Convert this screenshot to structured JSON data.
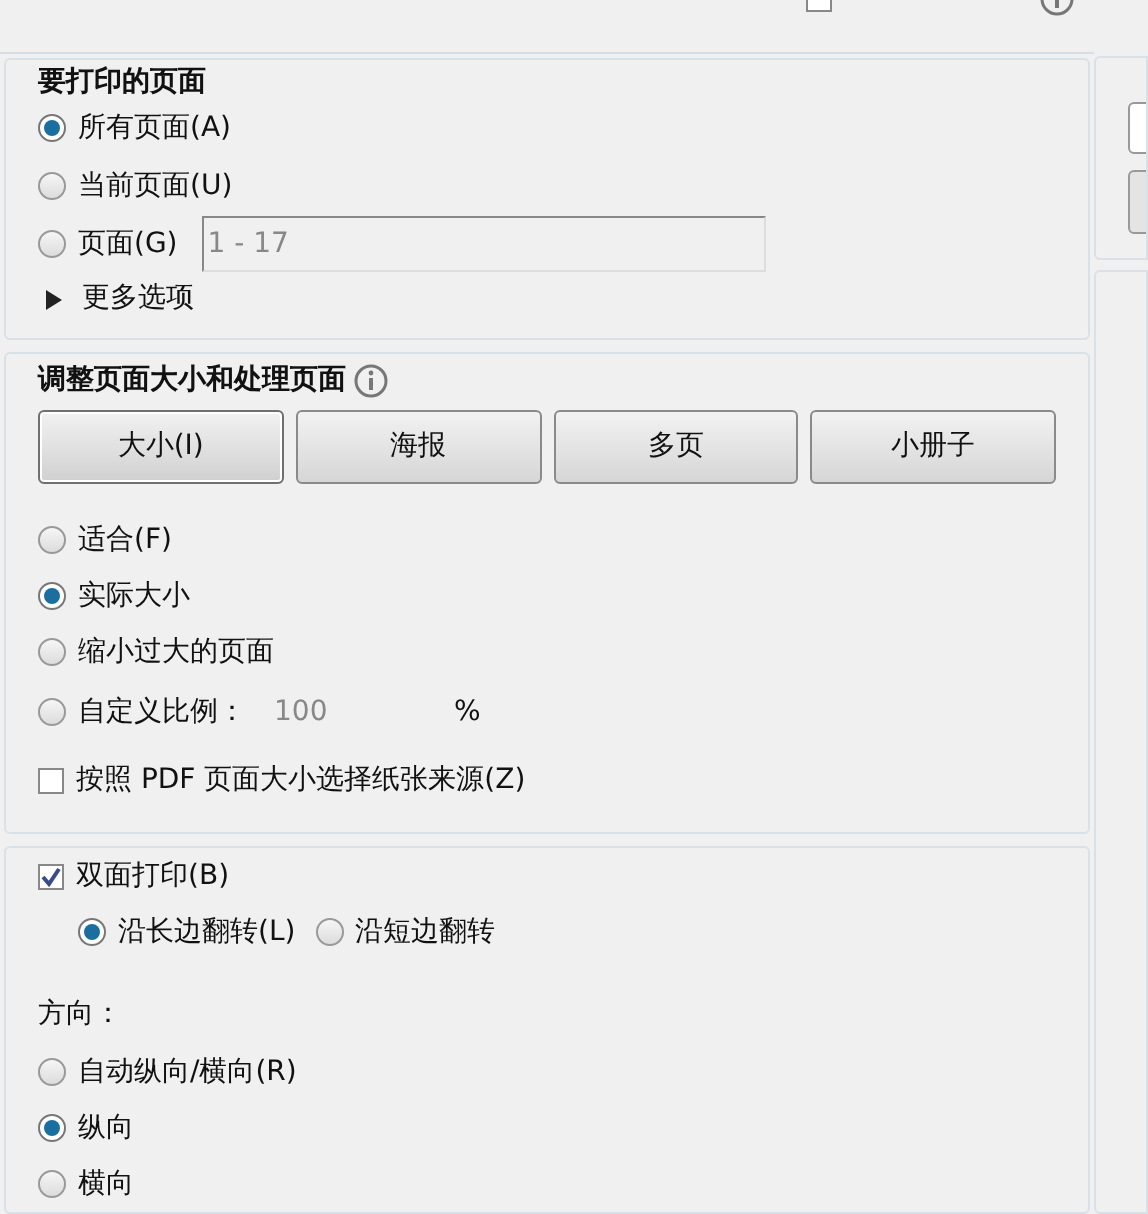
{
  "top_option": {
    "checked": false
  },
  "pages_section": {
    "title": "要打印的页面",
    "options": [
      {
        "label": "所有页面(A)",
        "selected": true
      },
      {
        "label": "当前页面(U)",
        "selected": false
      },
      {
        "label": "页面(G)",
        "selected": false,
        "range": "1 - 17"
      }
    ],
    "more_options": "更多选项"
  },
  "sizing_section": {
    "title": "调整页面大小和处理页面",
    "buttons": [
      {
        "label": "大小(I)",
        "selected": true
      },
      {
        "label": "海报",
        "selected": false
      },
      {
        "label": "多页",
        "selected": false
      },
      {
        "label": "小册子",
        "selected": false
      }
    ],
    "options": [
      {
        "label": "适合(F)",
        "selected": false
      },
      {
        "label": "实际大小",
        "selected": true
      },
      {
        "label": "缩小过大的页面",
        "selected": false
      },
      {
        "label": "自定义比例：",
        "selected": false,
        "value": "100",
        "unit": "%"
      }
    ],
    "paper_source": {
      "label": "按照 PDF 页面大小选择纸张来源(Z)",
      "checked": false
    }
  },
  "duplex_section": {
    "duplex": {
      "label": "双面打印(B)",
      "checked": true
    },
    "flip": [
      {
        "label": "沿长边翻转(L)",
        "selected": true
      },
      {
        "label": "沿短边翻转",
        "selected": false
      }
    ],
    "orientation_title": "方向：",
    "orientation": [
      {
        "label": "自动纵向/横向(R)",
        "selected": false
      },
      {
        "label": "纵向",
        "selected": true
      },
      {
        "label": "横向",
        "selected": false
      }
    ]
  }
}
